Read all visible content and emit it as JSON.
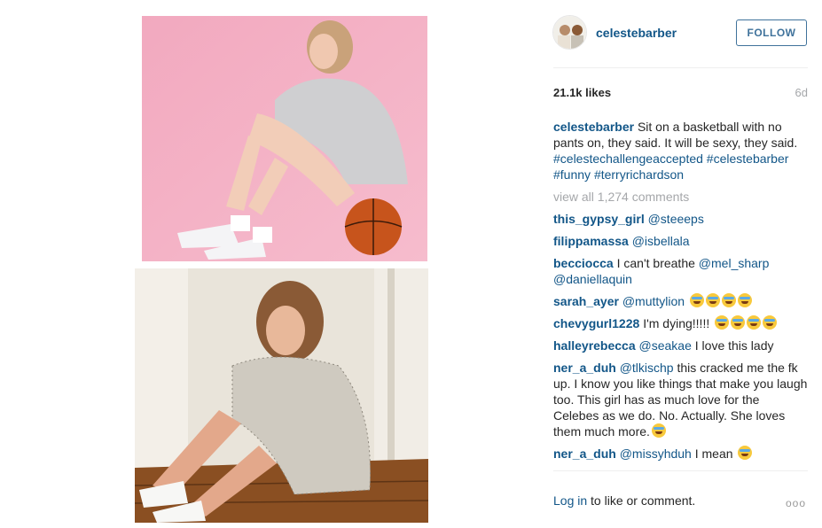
{
  "post": {
    "username": "celestebarber",
    "follow_label": "FOLLOW",
    "likes": "21.1k likes",
    "age": "6d",
    "caption": {
      "user": "celestebarber",
      "text": "Sit on a basketball with no pants on, they said. It will be sexy, they said.",
      "tags": [
        "#celestechallengeaccepted",
        "#celestebarber",
        "#funny",
        "#terryrichardson"
      ]
    },
    "view_all": "view all 1,274 comments",
    "comments": [
      {
        "user": "this_gypsy_girl",
        "mention": "@steeeps",
        "text": ""
      },
      {
        "user": "filippamassa",
        "mention": "@isbellala",
        "text": ""
      },
      {
        "user": "becciocca",
        "text": "I can't breathe",
        "mention": "@mel_sharp @daniellaquin"
      },
      {
        "user": "sarah_ayer",
        "mention": "@muttylion",
        "emoji": "😂😂😂😂"
      },
      {
        "user": "chevygurl1228",
        "text": "I'm dying!!!!!",
        "emoji": "😂😂😂😂"
      },
      {
        "user": "halleyrebecca",
        "mention": "@seakae",
        "text": "I love this lady"
      },
      {
        "user": "ner_a_duh",
        "mention": "@tlkischp",
        "text": "this cracked me the fk up. I know you like things that make you laugh too. This girl has as much love for the Celebes as we do. No. Actually. She loves them much more.",
        "emoji": "😂"
      },
      {
        "user": "ner_a_duh",
        "mention": "@missyhduh",
        "text": "I mean",
        "emoji": "😂"
      }
    ],
    "login_link": "Log in",
    "login_text": "to like or comment.",
    "more_label": "ooo"
  },
  "colors": {
    "link": "#125688",
    "follow": "#3f729b",
    "muted": "#a5a7aa"
  }
}
